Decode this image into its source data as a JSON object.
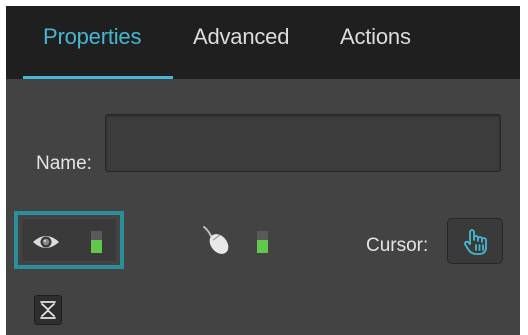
{
  "tabs": [
    {
      "label": "Properties",
      "active": true
    },
    {
      "label": "Advanced",
      "active": false
    },
    {
      "label": "Actions",
      "active": false
    }
  ],
  "name_field": {
    "label": "Name:",
    "value": ""
  },
  "visibility": {
    "icon": "eye-icon",
    "indicator_level": 0.6,
    "highlighted": true
  },
  "interactivity": {
    "icon": "mouse-icon",
    "indicator_level": 0.6
  },
  "cursor": {
    "label": "Cursor:",
    "icon": "hand-pointer-icon"
  },
  "collapse": {
    "icon": "collapse-icon"
  },
  "colors": {
    "accent": "#45b7d2",
    "highlight_border": "#2a8e9b",
    "indicator_on": "#63c74d",
    "panel_bg": "#434343",
    "tabbar_bg": "#1f1f1f"
  }
}
